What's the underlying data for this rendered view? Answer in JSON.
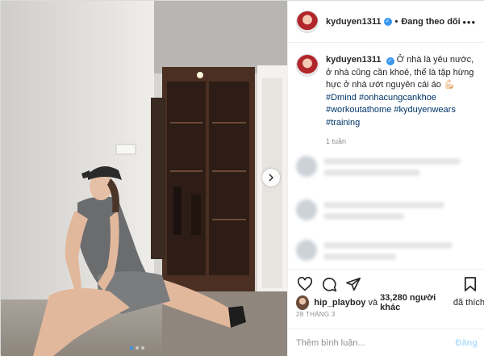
{
  "header": {
    "username": "kyduyen1311",
    "separator": "•",
    "follow_status": "Đang theo dõi",
    "more_label": "•••"
  },
  "caption": {
    "username": "kyduyen1311",
    "text": "Ở nhà là yêu nước, ở nhà cũng cần khoẻ, thể là tập hừng hực ở nhà ướt nguyên cái áo 💪🏻",
    "hashtags": [
      "#Dmind",
      "#onhacungcankhoe",
      "#workoutathome",
      "#kyduyenwears",
      "#training"
    ],
    "time_ago": "1 tuần"
  },
  "likes": {
    "first_user": "hip_playboy",
    "connector": " và ",
    "count_text": "33,280 người khác",
    "suffix": " đã thích"
  },
  "date": "28 THÁNG 3",
  "comment": {
    "placeholder": "Thêm bình luận...",
    "post_label": "Đăng"
  },
  "carousel": {
    "slide_count": 3,
    "active_index": 0
  },
  "colors": {
    "verified": "#3897f0",
    "hashtag": "#003569",
    "post_button": "#b2dffc",
    "muted": "#8e8e8e"
  },
  "icons": [
    "verified-badge-icon",
    "heart-icon",
    "comment-icon",
    "share-icon",
    "bookmark-icon",
    "chevron-right-icon"
  ]
}
